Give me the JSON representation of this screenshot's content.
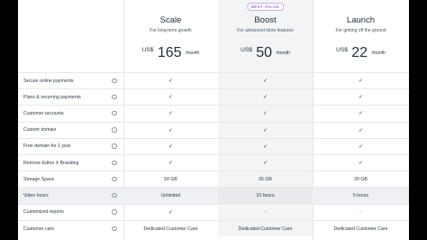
{
  "plans": [
    {
      "name": "Scale",
      "subtitle": "For long-term growth",
      "currency": "US$",
      "amount": "165",
      "period": "/month",
      "badge": ""
    },
    {
      "name": "Boost",
      "subtitle": "For advanced store features",
      "currency": "US$",
      "amount": "50",
      "period": "/month",
      "badge": "BEST VALUE"
    },
    {
      "name": "Launch",
      "subtitle": "For getting off the ground",
      "currency": "US$",
      "amount": "22",
      "period": "/month",
      "badge": ""
    }
  ],
  "features": [
    {
      "label": "Secure online payments",
      "values": [
        "check",
        "check",
        "check"
      ]
    },
    {
      "label": "Plans & recurring payments",
      "values": [
        "check",
        "check",
        "check"
      ]
    },
    {
      "label": "Customer accounts",
      "values": [
        "check",
        "check",
        "check"
      ]
    },
    {
      "label": "Custom domain",
      "values": [
        "check",
        "check",
        "check"
      ]
    },
    {
      "label": "Free domain for 1 year",
      "values": [
        "check",
        "check",
        "check"
      ]
    },
    {
      "label": "Remove Editor X Branding",
      "values": [
        "check",
        "check",
        "check"
      ]
    },
    {
      "label": "Storage Space",
      "values": [
        "50 GB",
        "35 GB",
        "20 GB"
      ]
    },
    {
      "label": "Video hours",
      "values": [
        "Unlimited",
        "10 hours",
        "5 hours"
      ],
      "highlight": true
    },
    {
      "label": "Customized reports",
      "values": [
        "check",
        "dash",
        "dash"
      ]
    },
    {
      "label": "Customer care",
      "values": [
        "Dedicated Customer Care",
        "Dedicated Customer Care",
        "Dedicated Customer Care"
      ]
    }
  ],
  "icons": {
    "info": "info-circle-icon",
    "check": "checkmark-icon",
    "dash": "dash-icon"
  },
  "glyphs": {
    "info": "i",
    "check": "✓",
    "dash": "–"
  }
}
